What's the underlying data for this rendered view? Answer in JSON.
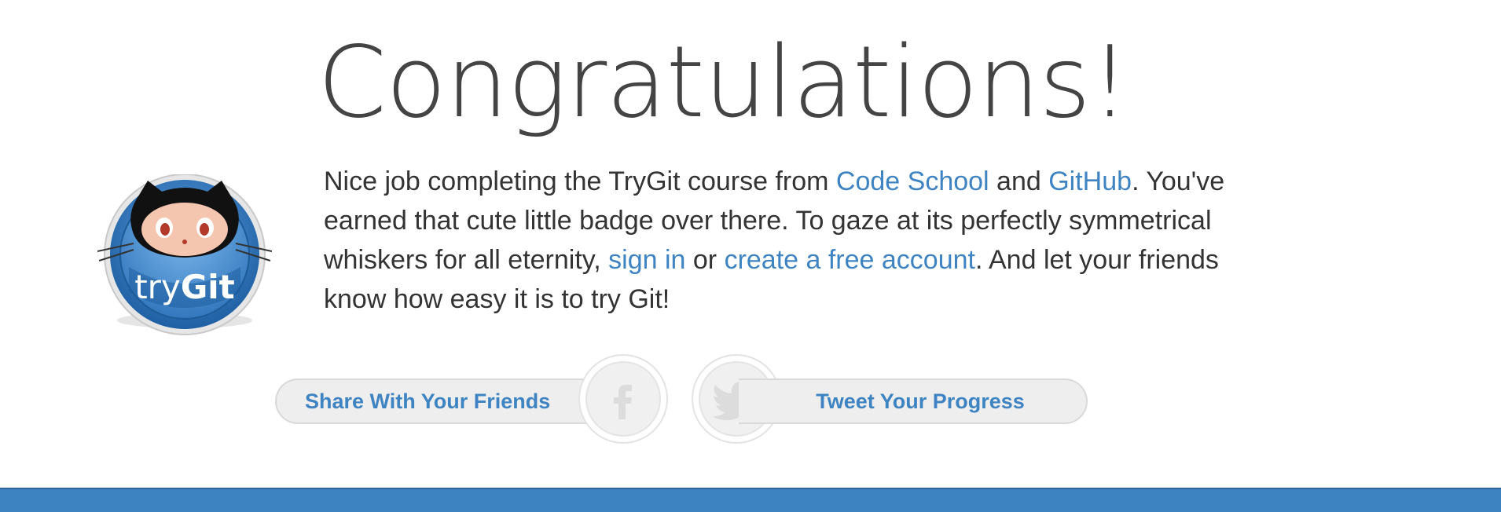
{
  "heading": "Congratulations!",
  "badge": {
    "text_pre": "try",
    "text_post": "Git",
    "colors": {
      "ring": "#2f78be",
      "inner": "#4a90d2",
      "outline": "#cfcfcf"
    }
  },
  "message": {
    "part1": "Nice job completing the TryGit course from ",
    "link_code_school": "Code School",
    "part2": " and ",
    "link_github": "GitHub",
    "part3": ". You've earned that cute little badge over there. To gaze at its perfectly symmetrical whiskers for all eternity, ",
    "link_sign_in": "sign in",
    "part4": " or ",
    "link_create_account": "create a free account",
    "part5": ". And let your friends know how easy it is to try Git!"
  },
  "share": {
    "facebook_label": "Share With Your Friends",
    "facebook_icon": "facebook-icon",
    "twitter_label": "Tweet Your Progress",
    "twitter_icon": "twitter-bird-icon"
  },
  "colors": {
    "link": "#3f84c2",
    "text": "#333333",
    "heading": "#444444",
    "footer": "#3d83c1"
  }
}
